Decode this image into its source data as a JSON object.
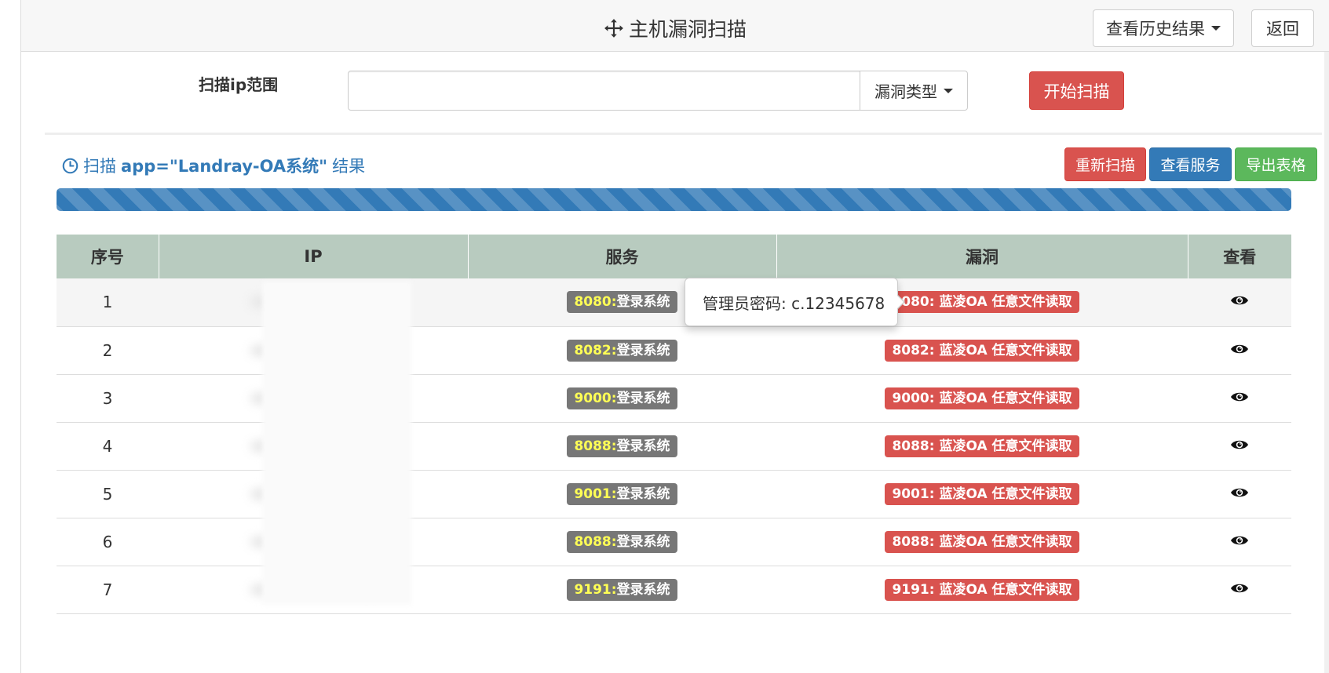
{
  "header": {
    "title": "主机漏洞扫描",
    "title_icon": "move-icon",
    "history_label": "查看历史结果",
    "back_label": "返回"
  },
  "scan_form": {
    "range_label": "扫描ip范围",
    "ip_value": "",
    "vuln_type_label": "漏洞类型",
    "start_label": "开始扫描"
  },
  "results": {
    "title_prefix": "扫描",
    "query": "app=\"Landray-OA系统\"",
    "title_suffix": "结果",
    "rescan_label": "重新扫描",
    "view_services_label": "查看服务",
    "export_label": "导出表格",
    "progress_fraction": 1.0,
    "columns": [
      "序号",
      "IP",
      "服务",
      "漏洞",
      "查看"
    ],
    "rows": [
      {
        "no": "1",
        "ip": "",
        "svc_port": "8080:",
        "svc_name": "登录系统",
        "vuln": "8080: 蓝凌OA 任意文件读取"
      },
      {
        "no": "2",
        "ip": "",
        "svc_port": "8082:",
        "svc_name": "登录系统",
        "vuln": "8082: 蓝凌OA 任意文件读取"
      },
      {
        "no": "3",
        "ip": "",
        "svc_port": "9000:",
        "svc_name": "登录系统",
        "vuln": "9000: 蓝凌OA 任意文件读取"
      },
      {
        "no": "4",
        "ip": "",
        "svc_port": "8088:",
        "svc_name": "登录系统",
        "vuln": "8088: 蓝凌OA 任意文件读取"
      },
      {
        "no": "5",
        "ip": "",
        "svc_port": "9001:",
        "svc_name": "登录系统",
        "vuln": "9001: 蓝凌OA 任意文件读取"
      },
      {
        "no": "6",
        "ip": "",
        "svc_port": "8088:",
        "svc_name": "登录系统",
        "vuln": "8088: 蓝凌OA 任意文件读取"
      },
      {
        "no": "7",
        "ip": "",
        "svc_port": "9191:",
        "svc_name": "登录系统",
        "vuln": "9191: 蓝凌OA 任意文件读取"
      }
    ]
  },
  "popover": {
    "text": "管理员密码: c.12345678"
  },
  "colors": {
    "danger": "#d9534f",
    "primary": "#337ab7",
    "success": "#5cb85c",
    "table_header": "#b8cbbf",
    "service_label": "#777777",
    "port_text": "#ffff55"
  }
}
